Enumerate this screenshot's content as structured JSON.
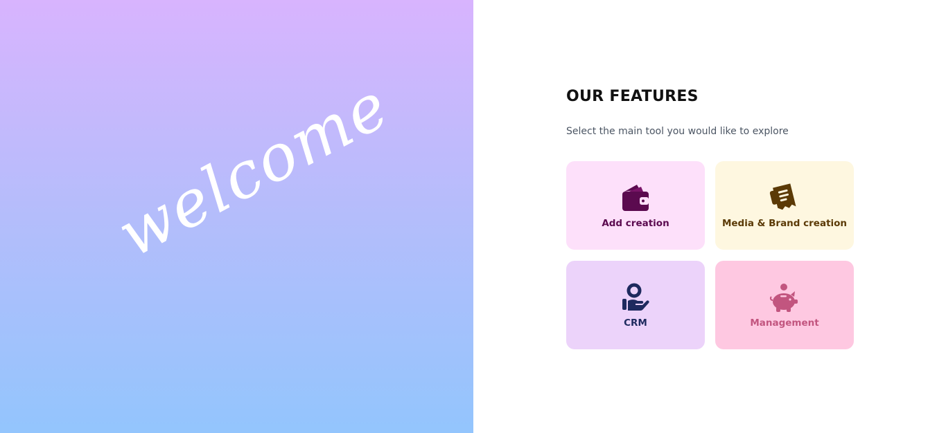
{
  "hero": {
    "welcome_text": "welcome"
  },
  "features": {
    "title": "OUR FEATURES",
    "subtitle": "Select the main tool you would like to explore",
    "cards": [
      {
        "label": "Add creation",
        "icon": "wallet-icon",
        "bg_color": "#fde0fa",
        "text_color": "#5b0a4f"
      },
      {
        "label": "Media & Brand creation",
        "icon": "receipt-icon",
        "bg_color": "#fef7e0",
        "text_color": "#5b3a06"
      },
      {
        "label": "CRM",
        "icon": "hand-user-icon",
        "bg_color": "#ecd3fa",
        "text_color": "#1e2a5e"
      },
      {
        "label": "Management",
        "icon": "piggy-bank-icon",
        "bg_color": "#fec8e1",
        "text_color": "#c2557f"
      }
    ]
  },
  "colors": {
    "gradient_top": "#d8b4fe",
    "gradient_bottom": "#93c5fd"
  }
}
